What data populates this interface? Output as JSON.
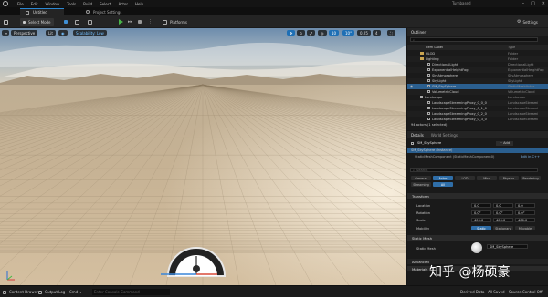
{
  "menubar": {
    "items": [
      "File",
      "Edit",
      "Window",
      "Tools",
      "Build",
      "Select",
      "Actor",
      "Help"
    ],
    "app_name": "Turnbased",
    "win_minimize": "–",
    "win_maximize": "□",
    "win_close": "✕"
  },
  "tabs": [
    {
      "label": "Untitled"
    },
    {
      "label": "Project Settings"
    }
  ],
  "toolbar": {
    "select_mode": "Select Mode",
    "platforms": "Platforms",
    "settings": "Settings"
  },
  "viewport": {
    "perspective": "Perspective",
    "lit": "Lit",
    "scalability": "Scalability: Low",
    "grid_snap": "10",
    "rot_snap": "10°",
    "scale_snap": "0.25",
    "cam_speed": "4"
  },
  "outliner": {
    "title": "Outliner",
    "col_label": "Item Label",
    "col_type": "Type",
    "rows": [
      {
        "label": "HLOD",
        "type": "Folder",
        "kind": "folder"
      },
      {
        "label": "Lighting",
        "type": "Folder",
        "kind": "folder"
      },
      {
        "label": "DirectionalLight",
        "type": "DirectionalLight",
        "kind": "actor"
      },
      {
        "label": "ExponentialHeightFog",
        "type": "ExponentialHeightFog",
        "kind": "actor"
      },
      {
        "label": "SkyAtmosphere",
        "type": "SkyAtmosphere",
        "kind": "actor"
      },
      {
        "label": "SkyLight",
        "type": "SkyLight",
        "kind": "actor"
      },
      {
        "label": "SM_SkySphere",
        "type": "StaticMeshActor",
        "kind": "actor"
      },
      {
        "label": "VolumetricCloud",
        "type": "VolumetricCloud",
        "kind": "actor"
      },
      {
        "label": "Landscape",
        "type": "Landscape",
        "kind": "actor"
      },
      {
        "label": "LandscapeStreamingProxy_0_0_0",
        "type": "LandscapeStreami",
        "kind": "actor"
      },
      {
        "label": "LandscapeStreamingProxy_0_1_0",
        "type": "LandscapeStreami",
        "kind": "actor"
      },
      {
        "label": "LandscapeStreamingProxy_0_2_0",
        "type": "LandscapeStreami",
        "kind": "actor"
      },
      {
        "label": "LandscapeStreamingProxy_0_3_0",
        "type": "LandscapeStreami",
        "kind": "actor"
      }
    ],
    "footer": "94 actors (1 selected)"
  },
  "details": {
    "tab_details": "Details",
    "tab_world": "World Settings",
    "actor_name": "SM_SkySphere",
    "add_label": "+ Add",
    "instance_row": "SM_SkySphere (Instance)",
    "component_row": "StaticMeshComponent (StaticMeshComponent0)",
    "edit_cpp": "Edit in C++",
    "search_placeholder": "Search",
    "filters_row1": [
      "General",
      "Actor",
      "LOD",
      "Misc",
      "Physics",
      "Rendering"
    ],
    "filters_row2": [
      "Streaming",
      "All"
    ],
    "transform": "Transform",
    "location_label": "Location",
    "rotation_label": "Rotation",
    "scale_label": "Scale",
    "location": [
      "0.0",
      "0.0",
      "0.0"
    ],
    "rotation": [
      "0.0°",
      "0.0°",
      "0.0°"
    ],
    "scale": [
      "400.0",
      "400.0",
      "400.0"
    ],
    "mobility_label": "Mobility",
    "mobility": [
      "Static",
      "Stationary",
      "Movable"
    ],
    "static_mesh_section": "Static Mesh",
    "static_mesh_label": "Static Mesh",
    "static_mesh_value": "SM_SkySphere",
    "advanced": "Advanced",
    "materials": "Materials"
  },
  "statusbar": {
    "content_drawer": "Content Drawer",
    "output_log": "Output Log",
    "cmd": "Cmd",
    "console_placeholder": "Enter Console Command",
    "derived_data": "Derived Data",
    "all_saved": "All Saved",
    "source_control": "Source Control Off"
  },
  "watermark": "知乎 @杨硕豪"
}
